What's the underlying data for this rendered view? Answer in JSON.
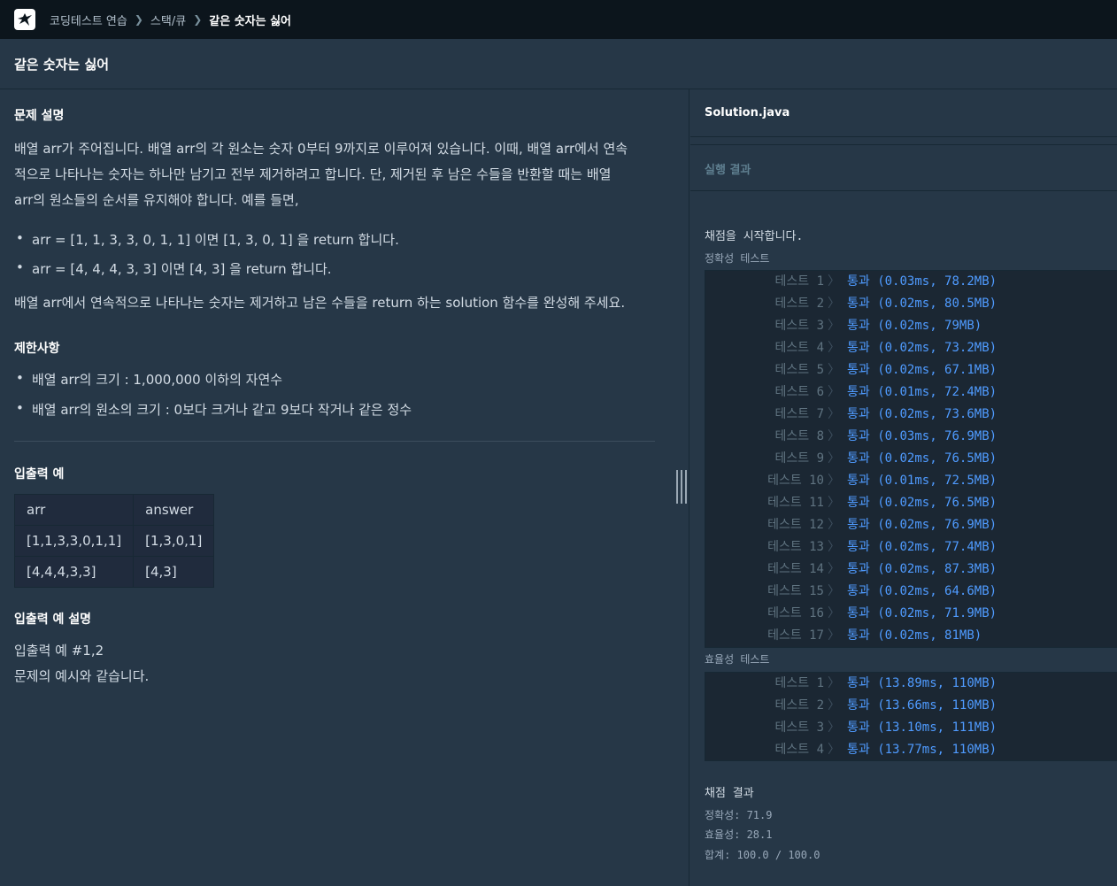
{
  "breadcrumbs": [
    {
      "label": "코딩테스트 연습"
    },
    {
      "label": "스택/큐"
    },
    {
      "label": "같은 숫자는 싫어"
    }
  ],
  "page_title": "같은 숫자는 싫어",
  "problem": {
    "heading": "문제 설명",
    "lines": [
      "배열 arr가 주어집니다. 배열 arr의 각 원소는 숫자 0부터 9까지로 이루어져 있습니다. 이때, 배열 arr에서 연속",
      "적으로 나타나는 숫자는 하나만 남기고 전부 제거하려고 합니다. 단, 제거된 후 남은 수들을 반환할 때는 배열",
      "arr의 원소들의 순서를 유지해야 합니다. 예를 들면,"
    ],
    "examples": [
      "arr = [1, 1, 3, 3, 0, 1, 1] 이면 [1, 3, 0, 1] 을 return 합니다.",
      "arr = [4, 4, 4, 3, 3] 이면 [4, 3] 을 return 합니다."
    ],
    "task": "배열 arr에서 연속적으로 나타나는 숫자는 제거하고 남은 수들을 return 하는 solution 함수를 완성해 주세요."
  },
  "constraints": {
    "heading": "제한사항",
    "items": [
      "배열 arr의 크기 : 1,000,000 이하의 자연수",
      "배열 arr의 원소의 크기 : 0보다 크거나 같고 9보다 작거나 같은 정수"
    ]
  },
  "io_example": {
    "heading": "입출력 예",
    "columns": [
      "arr",
      "answer"
    ],
    "rows": [
      [
        "[1,1,3,3,0,1,1]",
        "[1,3,0,1]"
      ],
      [
        "[4,4,4,3,3]",
        "[4,3]"
      ]
    ]
  },
  "io_explanation": {
    "heading": "입출력 예 설명",
    "lines": [
      "입출력 예 #1,2",
      "문제의 예시와 같습니다."
    ]
  },
  "editor": {
    "file_name": "Solution.java"
  },
  "results": {
    "label": "실행 결과",
    "start_text": "채점을 시작합니다.",
    "accuracy_label": "정확성  테스트",
    "accuracy_tests": [
      {
        "name": "테스트 1",
        "result": "통과 (0.03ms, 78.2MB)"
      },
      {
        "name": "테스트 2",
        "result": "통과 (0.02ms, 80.5MB)"
      },
      {
        "name": "테스트 3",
        "result": "통과 (0.02ms, 79MB)"
      },
      {
        "name": "테스트 4",
        "result": "통과 (0.02ms, 73.2MB)"
      },
      {
        "name": "테스트 5",
        "result": "통과 (0.02ms, 67.1MB)"
      },
      {
        "name": "테스트 6",
        "result": "통과 (0.01ms, 72.4MB)"
      },
      {
        "name": "테스트 7",
        "result": "통과 (0.02ms, 73.6MB)"
      },
      {
        "name": "테스트 8",
        "result": "통과 (0.03ms, 76.9MB)"
      },
      {
        "name": "테스트 9",
        "result": "통과 (0.02ms, 76.5MB)"
      },
      {
        "name": "테스트 10",
        "result": "통과 (0.01ms, 72.5MB)"
      },
      {
        "name": "테스트 11",
        "result": "통과 (0.02ms, 76.5MB)"
      },
      {
        "name": "테스트 12",
        "result": "통과 (0.02ms, 76.9MB)"
      },
      {
        "name": "테스트 13",
        "result": "통과 (0.02ms, 77.4MB)"
      },
      {
        "name": "테스트 14",
        "result": "통과 (0.02ms, 87.3MB)"
      },
      {
        "name": "테스트 15",
        "result": "통과 (0.02ms, 64.6MB)"
      },
      {
        "name": "테스트 16",
        "result": "통과 (0.02ms, 71.9MB)"
      },
      {
        "name": "테스트 17",
        "result": "통과 (0.02ms, 81MB)"
      }
    ],
    "efficiency_label": "효율성  테스트",
    "efficiency_tests": [
      {
        "name": "테스트 1",
        "result": "통과 (13.89ms, 110MB)"
      },
      {
        "name": "테스트 2",
        "result": "통과 (13.66ms, 110MB)"
      },
      {
        "name": "테스트 3",
        "result": "통과 (13.10ms, 111MB)"
      },
      {
        "name": "테스트 4",
        "result": "통과 (13.77ms, 110MB)"
      }
    ],
    "final_heading": "채점 결과",
    "final_lines": [
      "정확성: 71.9",
      "효율성: 28.1",
      "합계: 100.0 / 100.0"
    ]
  },
  "colors": {
    "pass": "#4f9bff",
    "background": "#263747",
    "topbar": "#0c151c"
  }
}
